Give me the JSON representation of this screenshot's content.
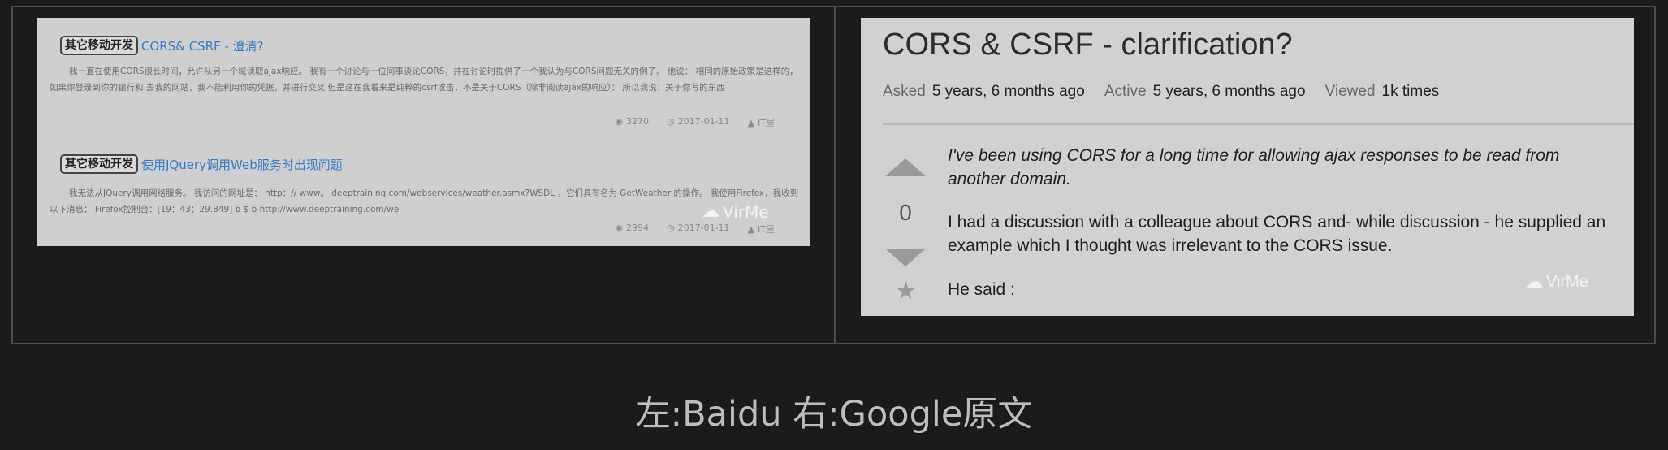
{
  "left": {
    "results": [
      {
        "tag": "其它移动开发",
        "title": "CORS& CSRF - 澄清?",
        "snippet": "我一直在使用CORS很长时间，允许从另一个域读取ajax响应。 我有一个讨论与一位同事谈论CORS，并在讨论时提供了一个我认为与CORS问题无关的例子。 他说： 相同的原始政策是这样的，如果你登录到你的银行和 去我的网站，我不能利用你的凭据，并进行交叉 但是这在我看来是纯粹的csrf攻击，不是关于CORS（除非阅读ajax的响应）： 所以我说：关于你写的东西",
        "views": "3270",
        "date": "2017-01-11",
        "author": "IT屋"
      },
      {
        "tag": "其它移动开发",
        "title": "使用JQuery调用Web服务时出现问题",
        "snippet": "我无法从JQuery调用网络服务。 我访问的网址是： http：// www。 deeptraining.com/webservices/weather.asmx?WSDL ，它们具有名为 GetWeather 的操作。 我使用Firefox，我收到以下消息： Firefox控制台：[19：43：29.849] b $ b http://www.deeptraining.com/we",
        "views": "2994",
        "date": "2017-01-11",
        "author": "IT屋"
      }
    ],
    "watermark": "VirMe"
  },
  "right": {
    "title": "CORS & CSRF - clarification?",
    "stats": [
      {
        "label": "Asked",
        "value": "5 years, 6 months ago"
      },
      {
        "label": "Active",
        "value": "5 years, 6 months ago"
      },
      {
        "label": "Viewed",
        "value": "1k times"
      }
    ],
    "vote_count": "0",
    "paragraphs": [
      "I've been using CORS for a long time for allowing ajax responses to be read from another domain.",
      "I had a discussion with a colleague about CORS and- while discussion - he supplied an example which I thought was irrelevant to the CORS issue.",
      "He said :"
    ],
    "watermark": "VirMe"
  },
  "caption": "左:Baidu 右:Google原文",
  "icons": {
    "views": "eye-icon",
    "date": "clock-icon",
    "author": "person-icon",
    "wechat": "wechat-icon",
    "vote_up": "arrow-up-icon",
    "vote_down": "arrow-down-icon",
    "favorite": "star-icon"
  }
}
